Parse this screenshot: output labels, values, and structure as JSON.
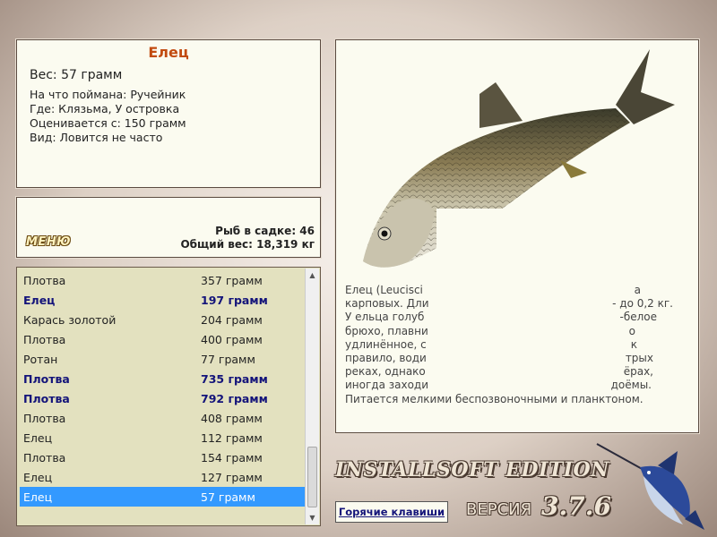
{
  "info": {
    "fish_name": "Елец",
    "weight": "Вес: 57 грамм",
    "lines": [
      "На что поймана: Ручейник",
      "Где: Клязьма, У островка",
      "Оценивается с: 150 грамм",
      "Вид: Ловится не часто"
    ]
  },
  "status": {
    "menu_label": "МЕНЮ",
    "fish_in_cage": "Рыб в садке: 46",
    "total_weight": "Общий вес: 18,319 кг"
  },
  "catch_list": [
    {
      "name": "Плотва",
      "weight": "357 грамм",
      "bold": false,
      "selected": false
    },
    {
      "name": "Елец",
      "weight": "197 грамм",
      "bold": true,
      "selected": false
    },
    {
      "name": "Карась золотой",
      "weight": "204 грамм",
      "bold": false,
      "selected": false
    },
    {
      "name": "Плотва",
      "weight": "400 грамм",
      "bold": false,
      "selected": false
    },
    {
      "name": "Ротан",
      "weight": "77 грамм",
      "bold": false,
      "selected": false
    },
    {
      "name": "Плотва",
      "weight": "735 грамм",
      "bold": true,
      "selected": false
    },
    {
      "name": "Плотва",
      "weight": "792 грамм",
      "bold": true,
      "selected": false
    },
    {
      "name": "Плотва",
      "weight": "408 грамм",
      "bold": false,
      "selected": false
    },
    {
      "name": "Елец",
      "weight": "112 грамм",
      "bold": false,
      "selected": false
    },
    {
      "name": "Плотва",
      "weight": "154 грамм",
      "bold": false,
      "selected": false
    },
    {
      "name": "Елец",
      "weight": "127 грамм",
      "bold": false,
      "selected": false
    },
    {
      "name": "Елец",
      "weight": "57 грамм",
      "bold": false,
      "selected": true
    }
  ],
  "description": {
    "lines": [
      "Елец (Leucisci",
      "карповых. Дли",
      "У ельца голуб",
      "брюхо, плавни",
      "удлинённое, с",
      "правило, води",
      "реках, однако",
      "иногда заходи",
      "Питается мелкими беспозвоночными и планктоном."
    ],
    "right_fragments": [
      "а",
      "- до 0,2 кг.",
      "-белое",
      "о",
      "к",
      "трых",
      "ёрах,",
      "доёмы."
    ]
  },
  "branding": {
    "edition": "INSTALLSOFT EDITION",
    "version_label": "ВЕРСИЯ",
    "version_number": "3.7.6"
  },
  "buttons": {
    "hotkeys": "Горячие клавиши"
  },
  "colors": {
    "accent_name": "#c24b10",
    "bold_row": "#14147a",
    "selection": "#3399ff",
    "list_bg": "#e3e1bf",
    "panel_bg": "#fbfbf0"
  },
  "icons": {
    "fish_image": "dace-fish-illustration",
    "logo": "marlin-logo"
  }
}
